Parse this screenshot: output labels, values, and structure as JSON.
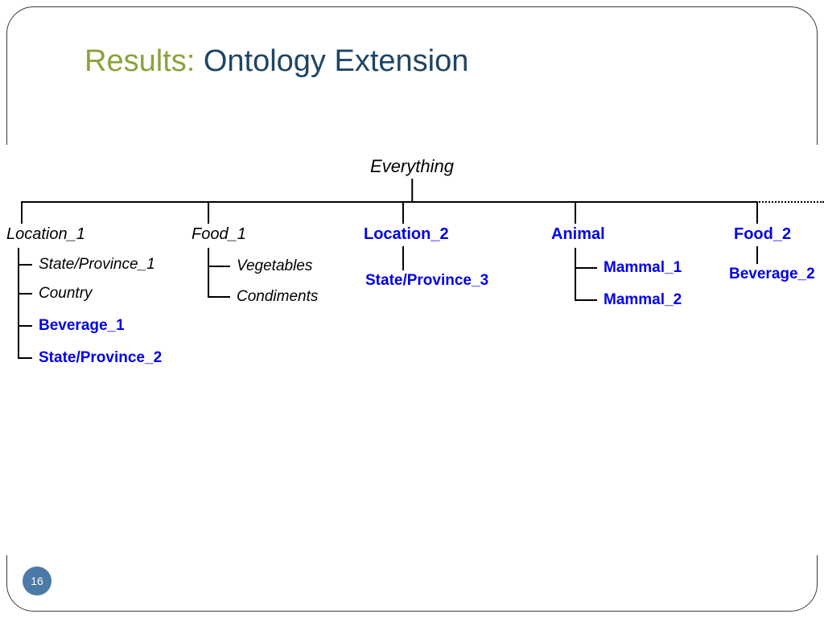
{
  "title": {
    "accent": "Results:",
    "rest": " Ontology Extension"
  },
  "page_number": "16",
  "tree": {
    "root": "Everything",
    "branches": {
      "location1": {
        "label": "Location_1",
        "style": "italic",
        "children": {
          "c0": {
            "label": "State/Province_1",
            "style": "italic"
          },
          "c1": {
            "label": "Country",
            "style": "italic"
          },
          "c2": {
            "label": "Beverage_1",
            "style": "blue"
          },
          "c3": {
            "label": "State/Province_2",
            "style": "blue"
          }
        }
      },
      "food1": {
        "label": "Food_1",
        "style": "italic",
        "children": {
          "c0": {
            "label": "Vegetables",
            "style": "italic"
          },
          "c1": {
            "label": "Condiments",
            "style": "italic"
          }
        }
      },
      "location2": {
        "label": "Location_2",
        "style": "blue",
        "children": {
          "c0": {
            "label": "State/Province_3",
            "style": "blue"
          }
        }
      },
      "animal": {
        "label": "Animal",
        "style": "blue",
        "children": {
          "c0": {
            "label": "Mammal_1",
            "style": "blue"
          },
          "c1": {
            "label": "Mammal_2",
            "style": "blue"
          }
        }
      },
      "food2": {
        "label": "Food_2",
        "style": "blue",
        "children": {
          "c0": {
            "label": "Beverage_2",
            "style": "blue"
          }
        }
      }
    }
  }
}
